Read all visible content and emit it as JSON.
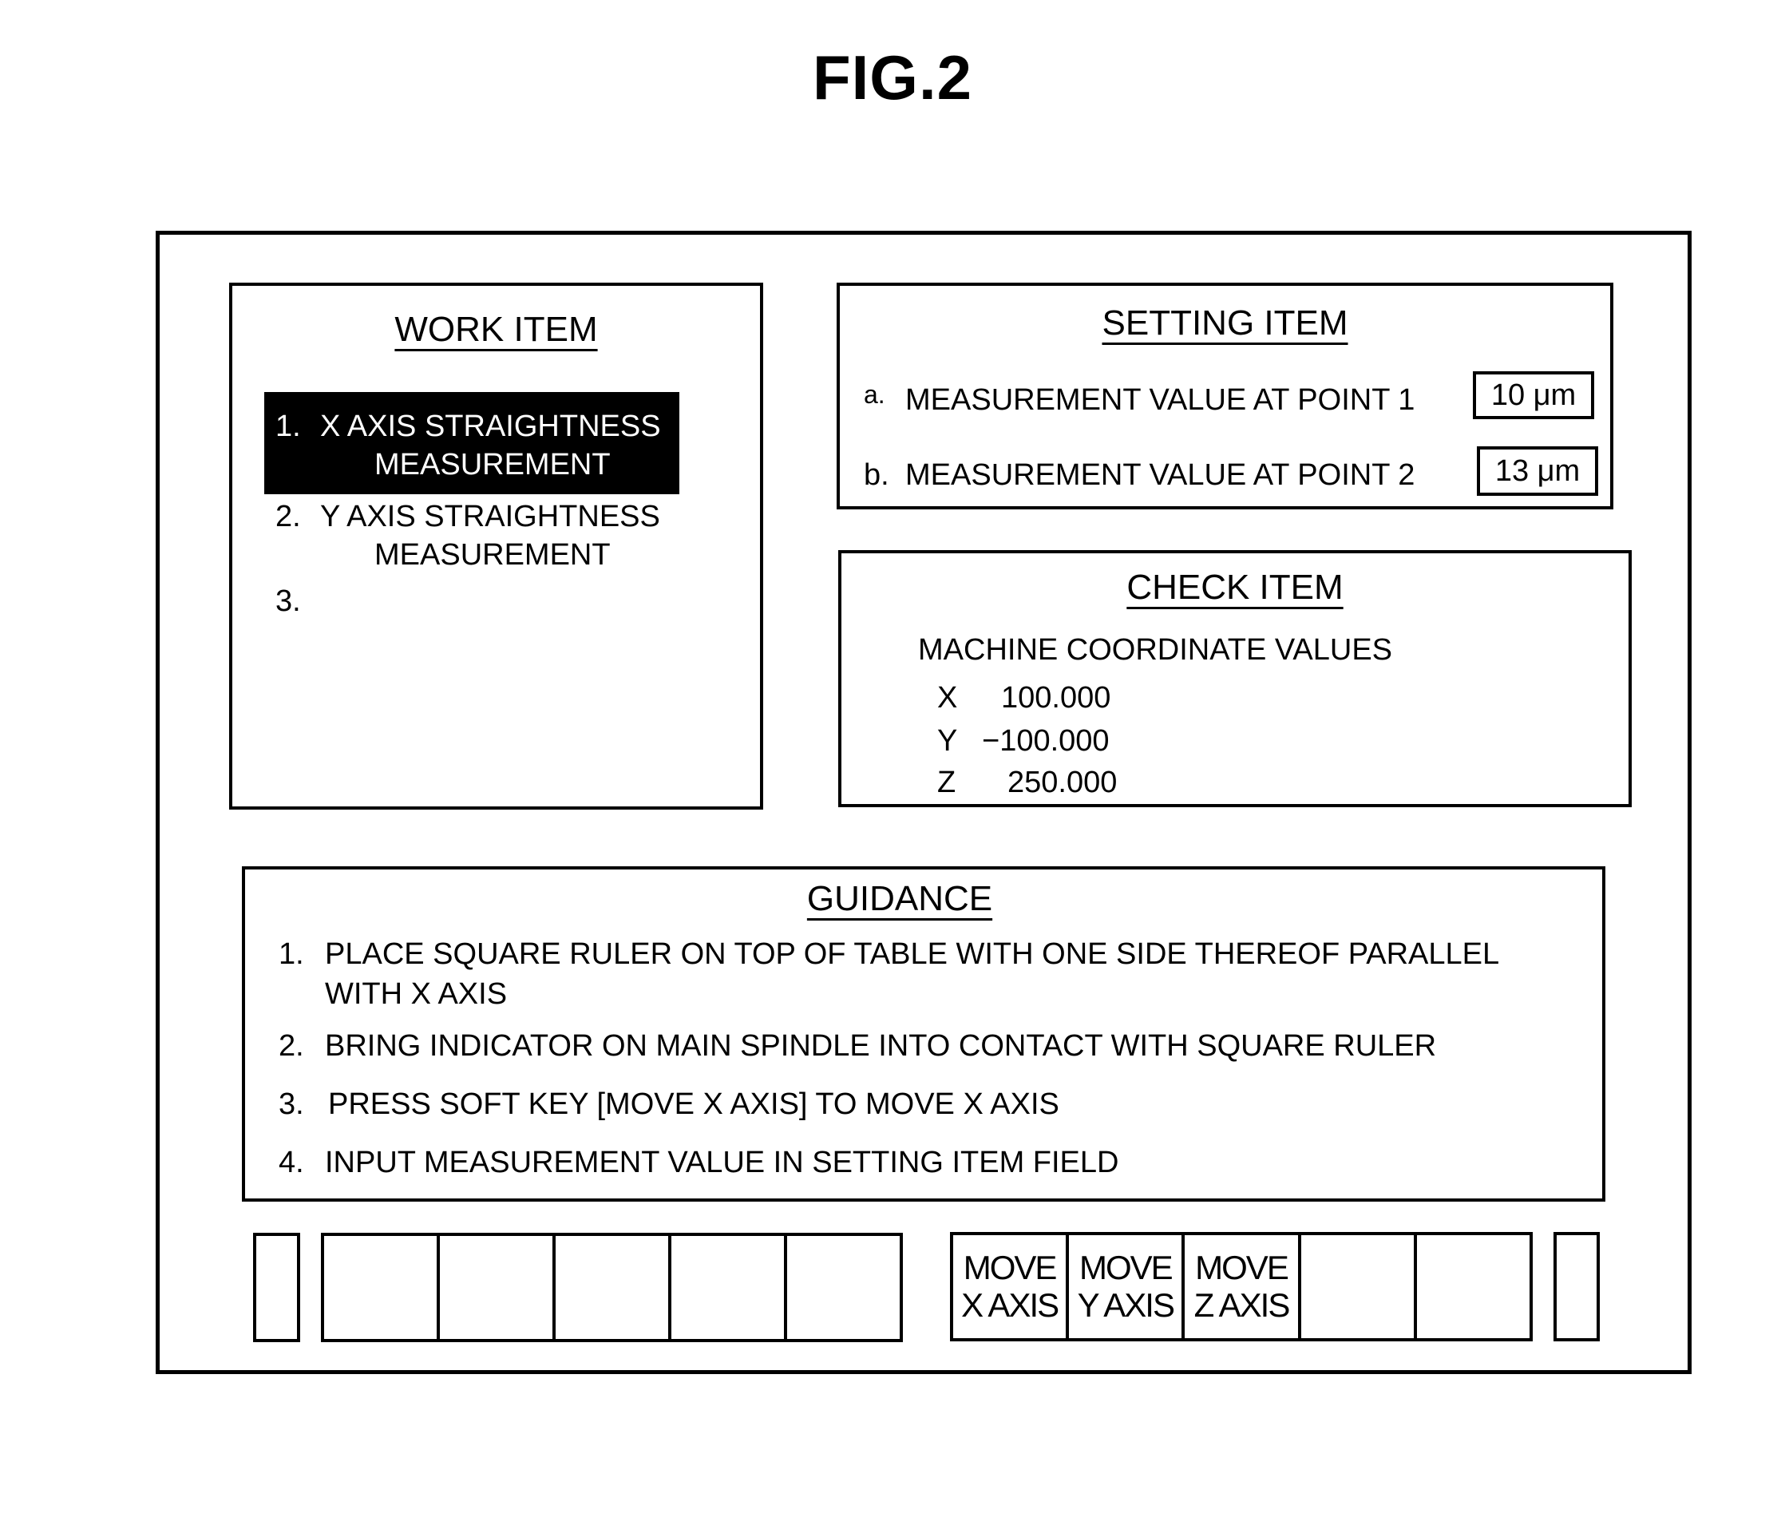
{
  "figure_title": "FIG.2",
  "work_item": {
    "title": "WORK ITEM",
    "items": [
      {
        "number": "1.",
        "line1": "X AXIS STRAIGHTNESS",
        "line2": "MEASUREMENT",
        "selected": true
      },
      {
        "number": "2.",
        "line1": "Y AXIS STRAIGHTNESS",
        "line2": "MEASUREMENT",
        "selected": false
      },
      {
        "number": "3.",
        "line1": "",
        "line2": "",
        "selected": false
      }
    ]
  },
  "setting_item": {
    "title": "SETTING ITEM",
    "fields": [
      {
        "label_prefix": "a.",
        "label": "MEASUREMENT VALUE AT POINT 1",
        "value": "10 μm"
      },
      {
        "label_prefix": "b.",
        "label": "MEASUREMENT VALUE AT POINT 2",
        "value": "13 μm"
      }
    ]
  },
  "check_item": {
    "title": "CHECK ITEM",
    "subtitle": "MACHINE COORDINATE VALUES",
    "coordinates": [
      {
        "axis": "X",
        "value": "100.000"
      },
      {
        "axis": "Y",
        "value": "−100.000"
      },
      {
        "axis": "Z",
        "value": "250.000"
      }
    ]
  },
  "guidance": {
    "title": "GUIDANCE",
    "steps": [
      {
        "number": "1.",
        "line1": "PLACE SQUARE RULER ON TOP OF TABLE WITH ONE SIDE THEREOF PARALLEL",
        "line2": "WITH X AXIS"
      },
      {
        "number": "2.",
        "line1": "BRING INDICATOR ON MAIN SPINDLE INTO CONTACT WITH SQUARE RULER",
        "line2": ""
      },
      {
        "number": "3.",
        "line1": "PRESS SOFT KEY [MOVE X AXIS] TO MOVE X AXIS",
        "line2": ""
      },
      {
        "number": "4.",
        "line1": "INPUT MEASUREMENT VALUE IN SETTING ITEM FIELD",
        "line2": ""
      }
    ]
  },
  "soft_keys": {
    "left_group": [
      {
        "line1": "",
        "line2": ""
      },
      {
        "line1": "",
        "line2": ""
      },
      {
        "line1": "",
        "line2": ""
      },
      {
        "line1": "",
        "line2": ""
      },
      {
        "line1": "",
        "line2": ""
      }
    ],
    "right_group": [
      {
        "line1": "MOVE",
        "line2": "X AXIS"
      },
      {
        "line1": "MOVE",
        "line2": "Y AXIS"
      },
      {
        "line1": "MOVE",
        "line2": "Z AXIS"
      },
      {
        "line1": "",
        "line2": ""
      },
      {
        "line1": "",
        "line2": ""
      }
    ]
  }
}
